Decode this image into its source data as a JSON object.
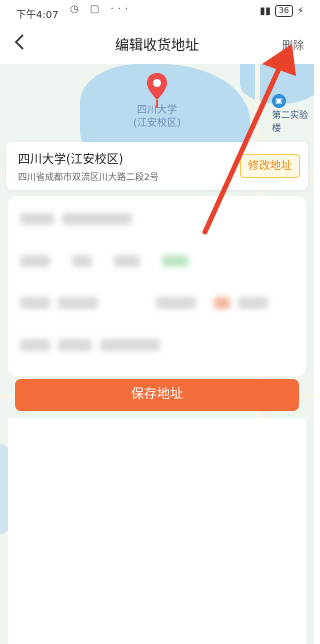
{
  "status_bar": {
    "time": "下午4:07",
    "battery": "36"
  },
  "navbar": {
    "title": "编辑收货地址",
    "delete_label": "删除"
  },
  "map": {
    "poi_name": "四川大学",
    "poi_sub": "(江安校区)",
    "nearby_poi": "第二实验楼"
  },
  "address_card": {
    "name": "四川大学(江安校区)",
    "detail": "四川省成都市双流区川大路二段2号",
    "edit_label": "修改地址"
  },
  "save_label": "保存地址",
  "colors": {
    "accent": "#f36d3b",
    "arrow": "#e8412c"
  }
}
